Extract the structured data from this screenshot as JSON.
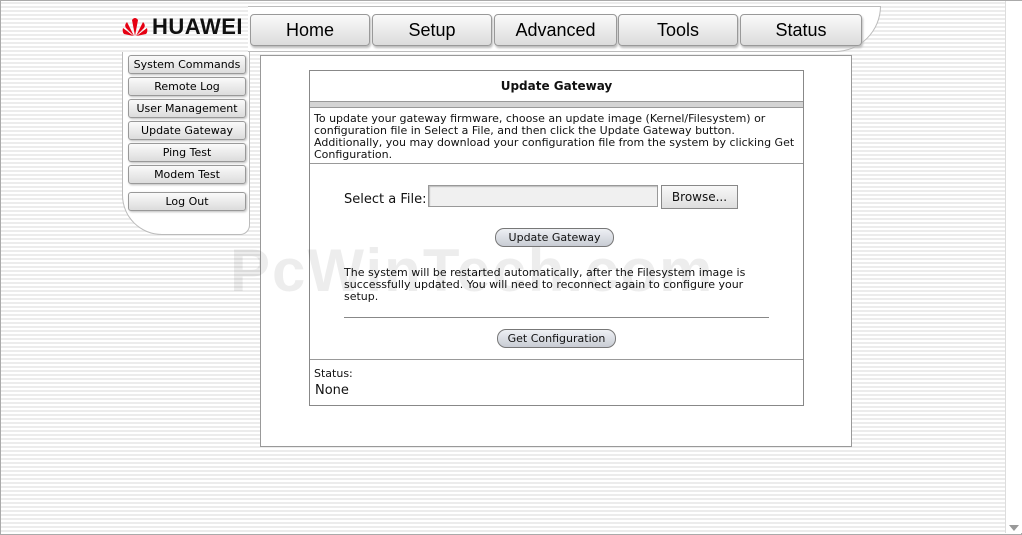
{
  "brand": {
    "name": "HUAWEI",
    "logo_color": "#e60012"
  },
  "topnav": {
    "tabs": [
      "Home",
      "Setup",
      "Advanced",
      "Tools",
      "Status"
    ]
  },
  "sidenav": {
    "items": [
      "System Commands",
      "Remote Log",
      "User Management",
      "Update Gateway",
      "Ping Test",
      "Modem Test",
      "Log Out"
    ]
  },
  "panel": {
    "title": "Update Gateway",
    "description": "To update your gateway firmware, choose an update image (Kernel/Filesystem) or configuration file in Select a File, and then click the Update Gateway button. Additionally, you may download your configuration file from the system by clicking Get Configuration.",
    "file_label": "Select a File:",
    "file_value": "",
    "browse_label": "Browse...",
    "update_button": "Update Gateway",
    "note": "The system will be restarted automatically, after the Filesystem image is successfully updated. You will need to reconnect again to configure your setup.",
    "get_config_button": "Get Configuration",
    "status_label": "Status:",
    "status_value": "None"
  },
  "watermark": "PcWinTech.com"
}
